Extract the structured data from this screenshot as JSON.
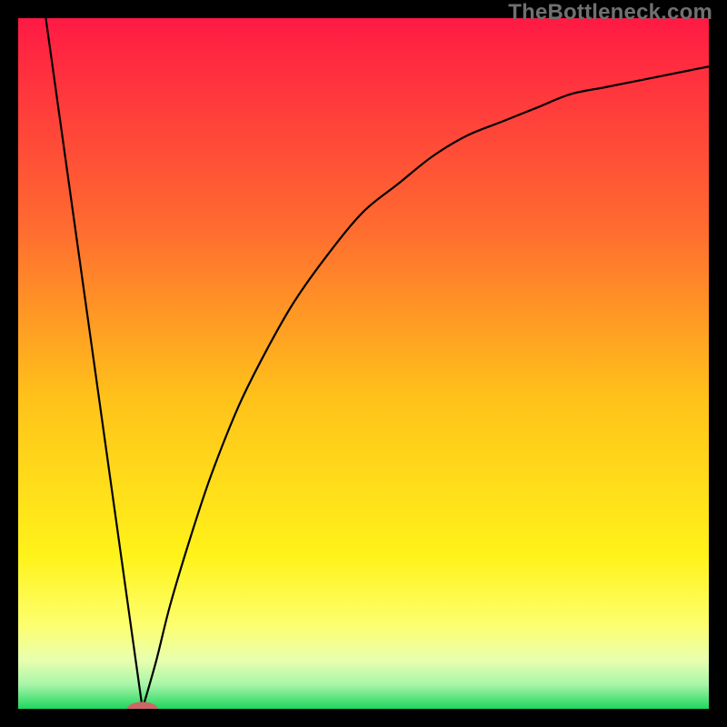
{
  "watermark": {
    "text": "TheBottleneck.com"
  },
  "colors": {
    "frame": "#000000",
    "curve": "#000000",
    "marker": "#cc6666"
  },
  "chart_data": {
    "type": "line",
    "title": "",
    "xlabel": "",
    "ylabel": "",
    "xlim": [
      0,
      100
    ],
    "ylim": [
      0,
      100
    ],
    "grid": false,
    "legend": false,
    "series": [
      {
        "name": "left-branch",
        "x": [
          4,
          18
        ],
        "y": [
          100,
          0
        ]
      },
      {
        "name": "right-branch",
        "x": [
          18,
          20,
          22,
          25,
          28,
          32,
          36,
          40,
          45,
          50,
          55,
          60,
          65,
          70,
          75,
          80,
          85,
          90,
          95,
          100
        ],
        "y": [
          0,
          7,
          15,
          25,
          34,
          44,
          52,
          59,
          66,
          72,
          76,
          80,
          83,
          85,
          87,
          89,
          90,
          91,
          92,
          93
        ]
      }
    ],
    "marker": {
      "x": 18,
      "y": 0,
      "rx": 2.2,
      "ry": 1.0,
      "color": "#cc6666"
    },
    "gradient_stops": [
      {
        "offset": 0.0,
        "color": "#ff1a44"
      },
      {
        "offset": 0.3,
        "color": "#ff6a30"
      },
      {
        "offset": 0.55,
        "color": "#ffc21a"
      },
      {
        "offset": 0.78,
        "color": "#fff31a"
      },
      {
        "offset": 0.88,
        "color": "#fdff70"
      },
      {
        "offset": 0.93,
        "color": "#e8ffb0"
      },
      {
        "offset": 0.965,
        "color": "#a8f5a8"
      },
      {
        "offset": 1.0,
        "color": "#1fd65f"
      }
    ]
  }
}
